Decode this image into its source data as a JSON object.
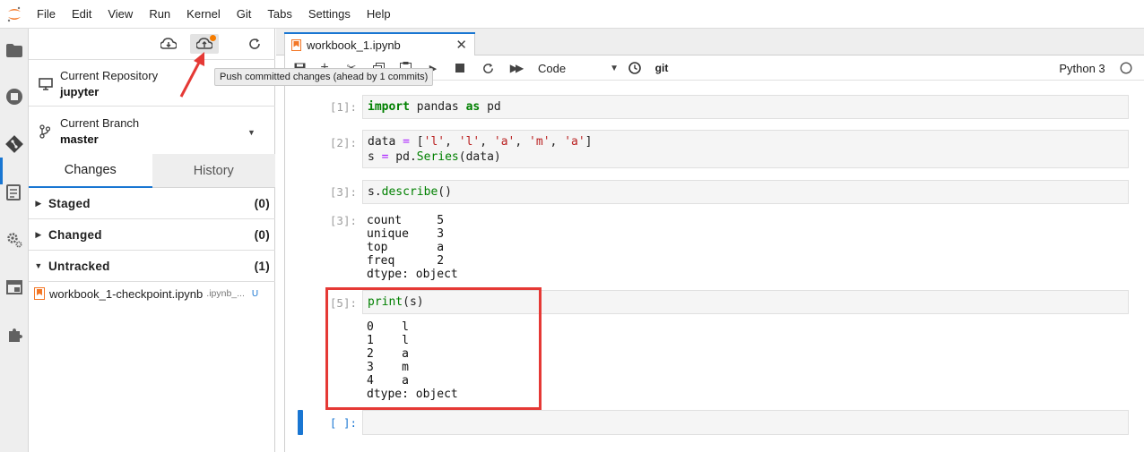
{
  "menubar": {
    "items": [
      "File",
      "Edit",
      "View",
      "Run",
      "Kernel",
      "Git",
      "Tabs",
      "Settings",
      "Help"
    ]
  },
  "git_panel": {
    "current_repository_label": "Current Repository",
    "current_repository_value": "jupyter",
    "current_branch_label": "Current Branch",
    "current_branch_value": "master",
    "tabs": [
      "Changes",
      "History"
    ],
    "groups": [
      {
        "name": "Staged",
        "count": "(0)",
        "expanded": false
      },
      {
        "name": "Changed",
        "count": "(0)",
        "expanded": false
      },
      {
        "name": "Untracked",
        "count": "(1)",
        "expanded": true
      }
    ],
    "untracked_file": {
      "name": "workbook_1-checkpoint.ipynb",
      "path": ".ipynb_...",
      "status": "U"
    },
    "push_tooltip": "Push committed changes (ahead by 1 commits)"
  },
  "notebook": {
    "tab_title": "workbook_1.ipynb",
    "cell_type": "Code",
    "git_label": "git",
    "kernel_name": "Python 3",
    "cells": [
      {
        "prompt": "[1]:",
        "code": "import pandas as pd"
      },
      {
        "prompt": "[2]:",
        "code": "data = ['l', 'l', 'a', 'm', 'a']\ns = pd.Series(data)"
      },
      {
        "prompt": "[3]:",
        "code": "s.describe()"
      },
      {
        "prompt": "[3]:",
        "output": "count     5\nunique    3\ntop       a\nfreq      2\ndtype: object"
      },
      {
        "prompt": "[5]:",
        "code": "print(s)"
      },
      {
        "output": "0    l\n1    l\n2    a\n3    m\n4    a\ndtype: object"
      },
      {
        "prompt": "[ ]:",
        "code": ""
      }
    ]
  },
  "colors": {
    "accent": "#1976d2",
    "highlight": "#e53935",
    "push_badge": "#f57c00",
    "jupyter_orange": "#f37726"
  }
}
